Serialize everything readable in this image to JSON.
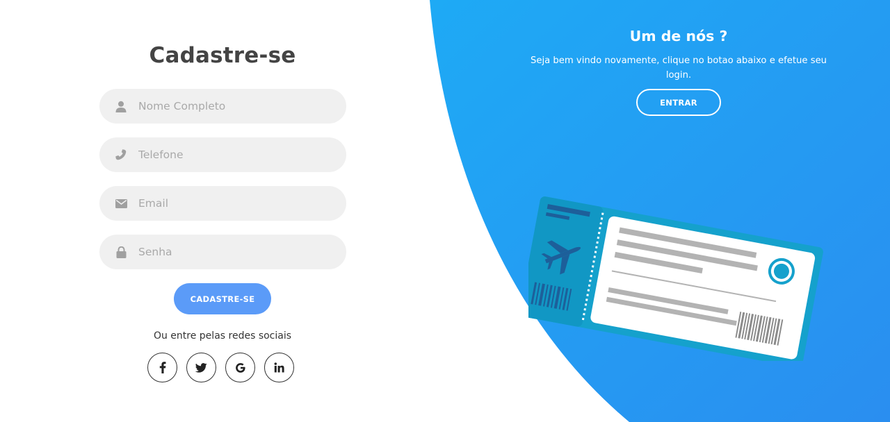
{
  "colors": {
    "panel_gradient_start": "#1eaaf5",
    "panel_gradient_end": "#2a90f0",
    "submit_button": "#5b9bf8",
    "field_background": "#f0f0f0",
    "title_text": "#444444"
  },
  "signup": {
    "title": "Cadastre-se",
    "fields": [
      {
        "icon": "user-icon",
        "placeholder": "Nome Completo",
        "value": ""
      },
      {
        "icon": "phone-icon",
        "placeholder": "Telefone",
        "value": ""
      },
      {
        "icon": "envelope-icon",
        "placeholder": "Email",
        "value": ""
      },
      {
        "icon": "lock-icon",
        "placeholder": "Senha",
        "value": ""
      }
    ],
    "submit_label": "CADASTRE-SE",
    "social_text": "Ou entre pelas redes sociais",
    "social": [
      {
        "icon": "facebook-icon",
        "label": "f"
      },
      {
        "icon": "twitter-icon",
        "label": ""
      },
      {
        "icon": "google-icon",
        "label": "G"
      },
      {
        "icon": "linkedin-icon",
        "label": "in"
      }
    ]
  },
  "login_panel": {
    "title": "Um de nós ?",
    "text": "Seja bem vindo novamente, clique no botao abaixo e efetue seu login.",
    "button_label": "ENTRAR"
  }
}
